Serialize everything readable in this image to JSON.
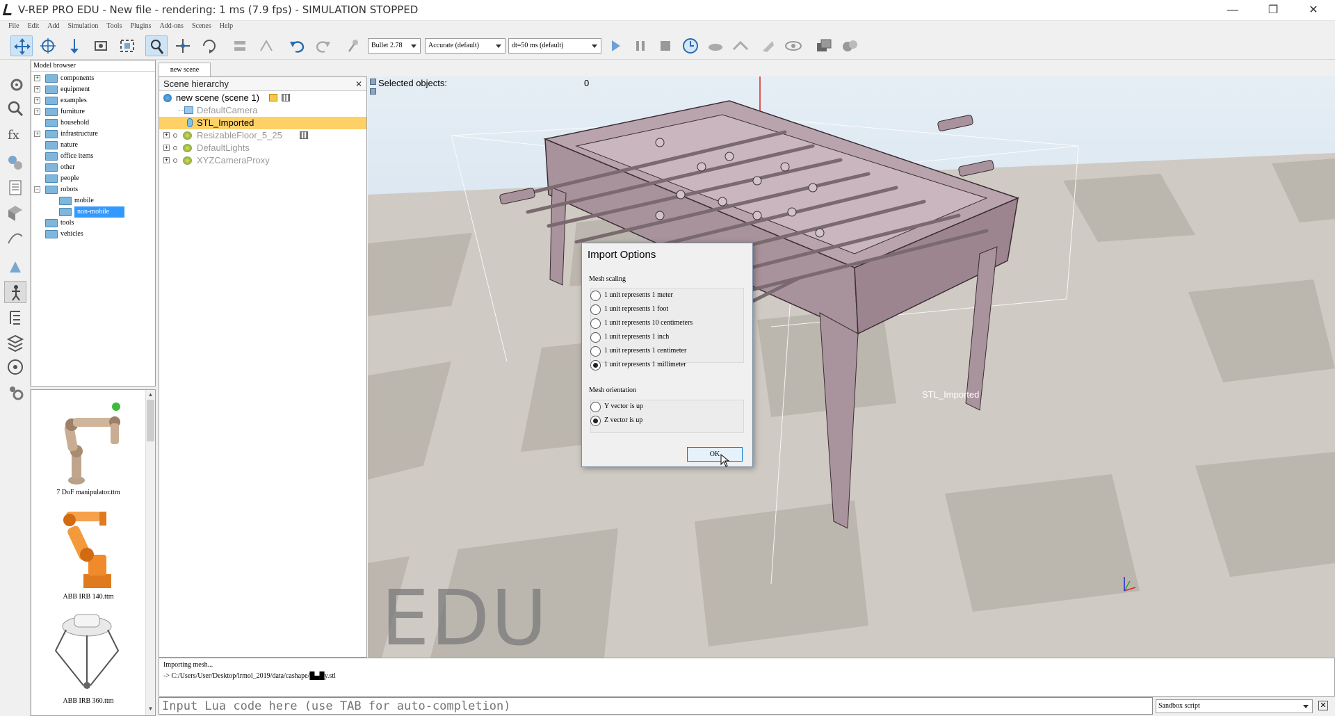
{
  "window": {
    "title": "V-REP PRO EDU - New file - rendering: 1 ms (7.9 fps) - SIMULATION STOPPED",
    "minimize": "—",
    "maximize": "❐",
    "close": "✕"
  },
  "menu": [
    "File",
    "Edit",
    "Add",
    "Simulation",
    "Tools",
    "Plugins",
    "Add-ons",
    "Scenes",
    "Help"
  ],
  "toolbar": {
    "engine": "Bullet 2.78",
    "accuracy": "Accurate (default)",
    "timestep": "dt=50 ms (default)"
  },
  "model_browser": {
    "title": "Model browser",
    "folders": [
      {
        "label": "components",
        "expandable": true
      },
      {
        "label": "equipment",
        "expandable": true
      },
      {
        "label": "examples",
        "expandable": true
      },
      {
        "label": "furniture",
        "expandable": true
      },
      {
        "label": "household",
        "expandable": false
      },
      {
        "label": "infrastructure",
        "expandable": true
      },
      {
        "label": "nature",
        "expandable": false
      },
      {
        "label": "office items",
        "expandable": false
      },
      {
        "label": "other",
        "expandable": false
      },
      {
        "label": "people",
        "expandable": false
      },
      {
        "label": "robots",
        "expandable": true,
        "expanded": true
      },
      {
        "label": "mobile",
        "child": true
      },
      {
        "label": "non-mobile",
        "child": true,
        "selected": true
      },
      {
        "label": "tools",
        "expandable": false
      },
      {
        "label": "vehicles",
        "expandable": false
      }
    ],
    "thumbnails": [
      "7 DoF manipulator.ttm",
      "ABB IRB 140.ttm",
      "ABB IRB 360.ttm"
    ]
  },
  "scene_tab": "new scene",
  "hierarchy": {
    "title": "Scene hierarchy",
    "close": "✕",
    "items": [
      {
        "label": "new scene (scene 1)",
        "level": 0
      },
      {
        "label": "DefaultCamera",
        "level": 1
      },
      {
        "label": "STL_Imported",
        "level": 1,
        "selected": true
      },
      {
        "label": "ResizableFloor_5_25",
        "level": 1
      },
      {
        "label": "DefaultLights",
        "level": 1
      },
      {
        "label": "XYZCameraProxy",
        "level": 1
      }
    ]
  },
  "viewport": {
    "selected_label": "Selected objects:",
    "selected_count": "0",
    "watermark": "EDU",
    "object_label": "STL_Imported"
  },
  "dialog": {
    "title": "Import Options",
    "scaling_label": "Mesh scaling",
    "scaling_options": [
      {
        "label": "1 unit represents 1 meter",
        "checked": false
      },
      {
        "label": "1 unit represents 1 foot",
        "checked": false
      },
      {
        "label": "1 unit represents 10 centimeters",
        "checked": false
      },
      {
        "label": "1 unit represents 1 inch",
        "checked": false
      },
      {
        "label": "1 unit represents 1 centimeter",
        "checked": false
      },
      {
        "label": "1 unit represents 1 millimeter",
        "checked": true
      }
    ],
    "orientation_label": "Mesh orientation",
    "orientation_options": [
      {
        "label": "Y vector is up",
        "checked": false
      },
      {
        "label": "Z vector is up",
        "checked": true
      }
    ],
    "ok": "OK"
  },
  "console": {
    "line1": "Importing mesh...",
    "line2": "-> C:/Users/User/Desktop/lrmol_2019/data/cashape/█▄█y.stl"
  },
  "lua_input_placeholder": "Input Lua code here (use TAB for auto-completion)",
  "script_selector": "Sandbox script",
  "console_close": "✕"
}
